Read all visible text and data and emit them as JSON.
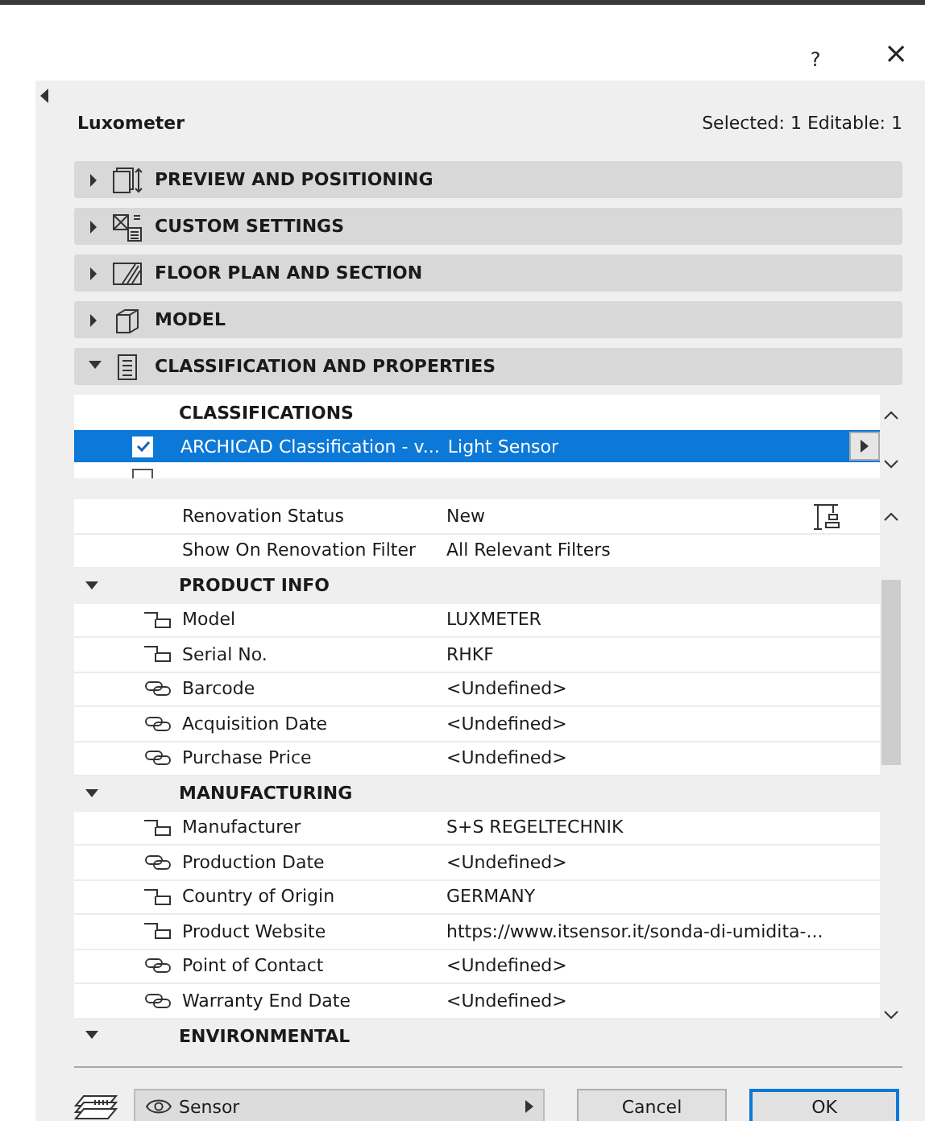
{
  "dialog": {
    "help": "?",
    "close": "×"
  },
  "panel": {
    "title": "Luxometer",
    "selection_info": "Selected: 1 Editable: 1"
  },
  "sections": [
    {
      "label": "PREVIEW AND POSITIONING",
      "expanded": false
    },
    {
      "label": "CUSTOM SETTINGS",
      "expanded": false
    },
    {
      "label": "FLOOR PLAN AND SECTION",
      "expanded": false
    },
    {
      "label": "MODEL",
      "expanded": false
    },
    {
      "label": "CLASSIFICATION AND PROPERTIES",
      "expanded": true
    }
  ],
  "classifications": {
    "heading": "CLASSIFICATIONS",
    "rows": [
      {
        "checked": true,
        "selected": true,
        "label": "ARCHICAD Classification - v...",
        "value": "Light Sensor"
      },
      {
        "checked": false,
        "selected": false
      }
    ]
  },
  "properties": [
    {
      "kind": "plain",
      "label": "Renovation Status",
      "value": "New"
    },
    {
      "kind": "plain",
      "label": "Show On Renovation Filter",
      "value": "All Relevant Filters"
    },
    {
      "kind": "group",
      "label": "PRODUCT INFO",
      "expanded": true
    },
    {
      "kind": "step",
      "label": "Model",
      "value": "LUXMETER"
    },
    {
      "kind": "step",
      "label": "Serial No.",
      "value": "RHKF"
    },
    {
      "kind": "link",
      "label": "Barcode",
      "value": "<Undefined>"
    },
    {
      "kind": "link",
      "label": "Acquisition Date",
      "value": "<Undefined>"
    },
    {
      "kind": "link",
      "label": "Purchase Price",
      "value": "<Undefined>"
    },
    {
      "kind": "group",
      "label": "MANUFACTURING",
      "expanded": true
    },
    {
      "kind": "step",
      "label": "Manufacturer",
      "value": "S+S REGELTECHNIK"
    },
    {
      "kind": "link",
      "label": "Production Date",
      "value": "<Undefined>"
    },
    {
      "kind": "step",
      "label": "Country of Origin",
      "value": "GERMANY"
    },
    {
      "kind": "step",
      "label": "Product Website",
      "value": "https://www.itsensor.it/sonda-di-umidita-..."
    },
    {
      "kind": "link",
      "label": "Point of Contact",
      "value": "<Undefined>"
    },
    {
      "kind": "link",
      "label": "Warranty End Date",
      "value": "<Undefined>"
    },
    {
      "kind": "group",
      "label": "ENVIRONMENTAL",
      "expanded": true
    }
  ],
  "footer": {
    "layer": "Sensor",
    "buttons": [
      {
        "label": "Cancel",
        "default": false
      },
      {
        "label": "OK",
        "default": true
      }
    ]
  }
}
